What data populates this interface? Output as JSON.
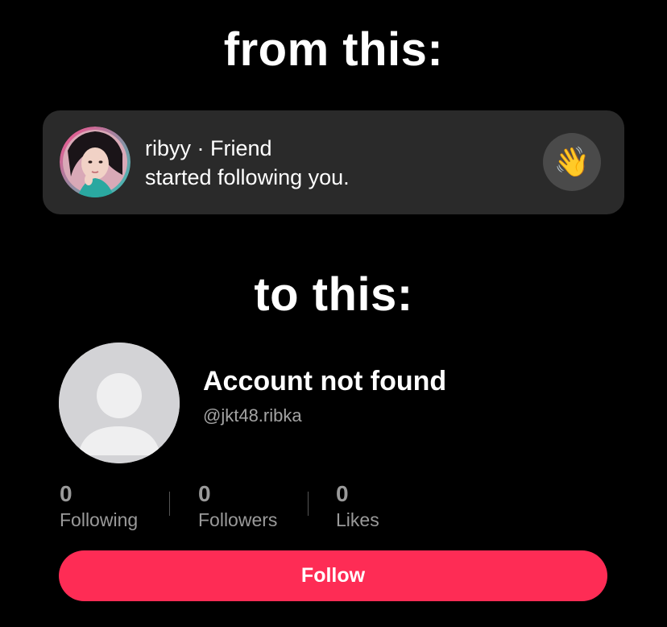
{
  "headings": {
    "top": "from this:",
    "middle": "to this:"
  },
  "notification": {
    "username": "ribyy",
    "separator": " · ",
    "relation": "Friend",
    "message": "started following you.",
    "action_icon": "waving-hand-emoji",
    "action_glyph": "👋"
  },
  "profile": {
    "name": "Account not found",
    "handle": "@jkt48.ribka",
    "stats": [
      {
        "value": "0",
        "label": "Following"
      },
      {
        "value": "0",
        "label": "Followers"
      },
      {
        "value": "0",
        "label": "Likes"
      }
    ],
    "follow_label": "Follow"
  },
  "colors": {
    "background": "#000000",
    "card": "#2a2a2a",
    "accent": "#fe2c55",
    "muted": "#9a9a9a"
  }
}
